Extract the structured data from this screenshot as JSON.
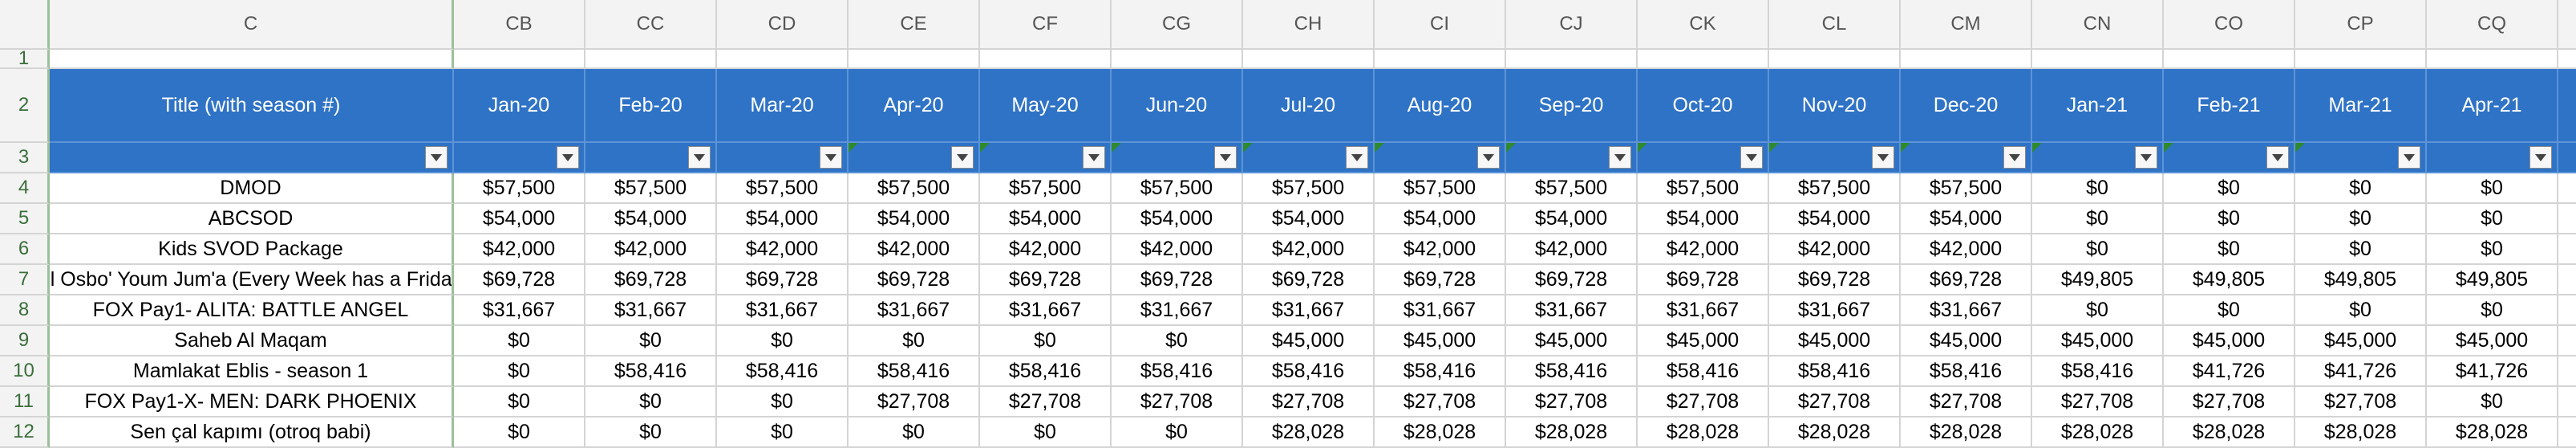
{
  "columns": [
    "C",
    "CB",
    "CC",
    "CD",
    "CE",
    "CF",
    "CG",
    "CH",
    "CI",
    "CJ",
    "CK",
    "CL",
    "CM",
    "CN",
    "CO",
    "CP",
    "CQ"
  ],
  "header": {
    "title": "Title (with season #)",
    "months": [
      "Jan-20",
      "Feb-20",
      "Mar-20",
      "Apr-20",
      "May-20",
      "Jun-20",
      "Jul-20",
      "Aug-20",
      "Sep-20",
      "Oct-20",
      "Nov-20",
      "Dec-20",
      "Jan-21",
      "Feb-21",
      "Mar-21",
      "Apr-21"
    ]
  },
  "row_numbers": [
    "1",
    "2",
    "3",
    "4",
    "5",
    "6",
    "7",
    "8",
    "9",
    "10",
    "11",
    "12"
  ],
  "rows": [
    {
      "title": "DMOD",
      "values": [
        "$57,500",
        "$57,500",
        "$57,500",
        "$57,500",
        "$57,500",
        "$57,500",
        "$57,500",
        "$57,500",
        "$57,500",
        "$57,500",
        "$57,500",
        "$57,500",
        "$0",
        "$0",
        "$0",
        "$0"
      ]
    },
    {
      "title": "ABCSOD",
      "values": [
        "$54,000",
        "$54,000",
        "$54,000",
        "$54,000",
        "$54,000",
        "$54,000",
        "$54,000",
        "$54,000",
        "$54,000",
        "$54,000",
        "$54,000",
        "$54,000",
        "$0",
        "$0",
        "$0",
        "$0"
      ]
    },
    {
      "title": "Kids SVOD Package",
      "values": [
        "$42,000",
        "$42,000",
        "$42,000",
        "$42,000",
        "$42,000",
        "$42,000",
        "$42,000",
        "$42,000",
        "$42,000",
        "$42,000",
        "$42,000",
        "$42,000",
        "$0",
        "$0",
        "$0",
        "$0"
      ]
    },
    {
      "title": "ol Osbo' Youm Jum'a (Every Week has a Friday",
      "values": [
        "$69,728",
        "$69,728",
        "$69,728",
        "$69,728",
        "$69,728",
        "$69,728",
        "$69,728",
        "$69,728",
        "$69,728",
        "$69,728",
        "$69,728",
        "$69,728",
        "$49,805",
        "$49,805",
        "$49,805",
        "$49,805"
      ]
    },
    {
      "title": "FOX Pay1- ALITA: BATTLE ANGEL",
      "values": [
        "$31,667",
        "$31,667",
        "$31,667",
        "$31,667",
        "$31,667",
        "$31,667",
        "$31,667",
        "$31,667",
        "$31,667",
        "$31,667",
        "$31,667",
        "$31,667",
        "$0",
        "$0",
        "$0",
        "$0"
      ]
    },
    {
      "title": "Saheb Al Maqam",
      "values": [
        "$0",
        "$0",
        "$0",
        "$0",
        "$0",
        "$0",
        "$45,000",
        "$45,000",
        "$45,000",
        "$45,000",
        "$45,000",
        "$45,000",
        "$45,000",
        "$45,000",
        "$45,000",
        "$45,000"
      ]
    },
    {
      "title": "Mamlakat Eblis - season 1",
      "values": [
        "$0",
        "$58,416",
        "$58,416",
        "$58,416",
        "$58,416",
        "$58,416",
        "$58,416",
        "$58,416",
        "$58,416",
        "$58,416",
        "$58,416",
        "$58,416",
        "$58,416",
        "$41,726",
        "$41,726",
        "$41,726"
      ]
    },
    {
      "title": "FOX Pay1-X- MEN: DARK PHOENIX",
      "values": [
        "$0",
        "$0",
        "$0",
        "$27,708",
        "$27,708",
        "$27,708",
        "$27,708",
        "$27,708",
        "$27,708",
        "$27,708",
        "$27,708",
        "$27,708",
        "$27,708",
        "$27,708",
        "$27,708",
        "$0"
      ]
    },
    {
      "title": "Sen çal kapımı (otroq babi)",
      "values": [
        "$0",
        "$0",
        "$0",
        "$0",
        "$0",
        "$0",
        "$28,028",
        "$28,028",
        "$28,028",
        "$28,028",
        "$28,028",
        "$28,028",
        "$28,028",
        "$28,028",
        "$28,028",
        "$28,028"
      ]
    }
  ],
  "flagged_filter_columns": [
    4,
    5,
    6,
    7,
    8,
    9,
    10,
    11,
    12,
    13,
    14,
    15
  ],
  "colors": {
    "header_blue": "#2f73c6",
    "flag_green": "#2f8a2f",
    "row_header_green": "#3a6e3a"
  }
}
